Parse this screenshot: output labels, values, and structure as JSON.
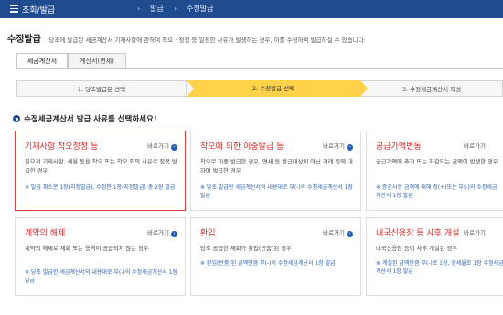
{
  "topbar": {
    "root": "조회/발급",
    "crumbs": [
      "발급",
      "수정발급"
    ]
  },
  "header": {
    "title": "수정발급",
    "description": "당초에 발급된 세금계산서 기재사항에 관하여 착오 · 정정 등 일정한 사유가 발생하는 경우, 이를 수정하여 발급하실 수 있습니다."
  },
  "tabs": [
    {
      "label": "세금계산서"
    },
    {
      "label": "계산서(면세)"
    }
  ],
  "steps": [
    {
      "label": "1. 당초발급분 선택"
    },
    {
      "label": "2. 수정발급 선택"
    },
    {
      "label": "3. 수정세금계산서 작성"
    }
  ],
  "section": {
    "title": "수정세금계산서 발급 사유를 선택하세요!"
  },
  "cards": [
    {
      "title": "기재사항 착오정정 등",
      "link": "바로가기",
      "desc": "필요적 기재사항, 세율 등을 착오 또는 착오 외의 사유로 잘못 발급한 경우",
      "note": "※ 발급 취소분 1장(지정발급), 수정분 1장(지정발급) 총 2장 발급"
    },
    {
      "title": "착오에 의한 이중발급 등",
      "link": "바로가기",
      "desc": "착오로 이중 발급한 경우, 면세 등 발급대상이 아닌 거래 등에 대하여 발급한 경우",
      "note": "※ 당초 발급한 세금계산서의 내용대로 부(-)의 수정세금계산서 1장 발급"
    },
    {
      "title": "공급가액변동",
      "link": "바로가기",
      "desc": "공급가액에 추가 또는 차감되는 금액이 발생한 경우",
      "note": "※ 증감사항 금액에 대해 정(+)또는 부(-)의 수정세금계산서 1장 발급"
    },
    {
      "title": "계약의 해제",
      "link": "바로가기",
      "desc": "계약의 해제로 재화 또는 용역이 공급되지 않는 경우",
      "note": "※ 당초 발급한 세금계산서의 내용대로 부(-)의 수정세금계산서 1장 발급"
    },
    {
      "title": "환입",
      "link": "바로가기",
      "desc": "당초 공급한 재화가 환입(반품)된 경우",
      "note": "※ 환입(반품)된 금액만큼 부(-)의 수정세금계산서 1장 발급"
    },
    {
      "title": "내국신용장 등 사후 개설",
      "link": "바로가기",
      "desc": "내국신용장 등이 사후 개설된 경우",
      "note": "※ 계설된 금액만큼 부(-)로 1장, 영세율로 1장 수정세금계산서 1장 발급"
    }
  ]
}
